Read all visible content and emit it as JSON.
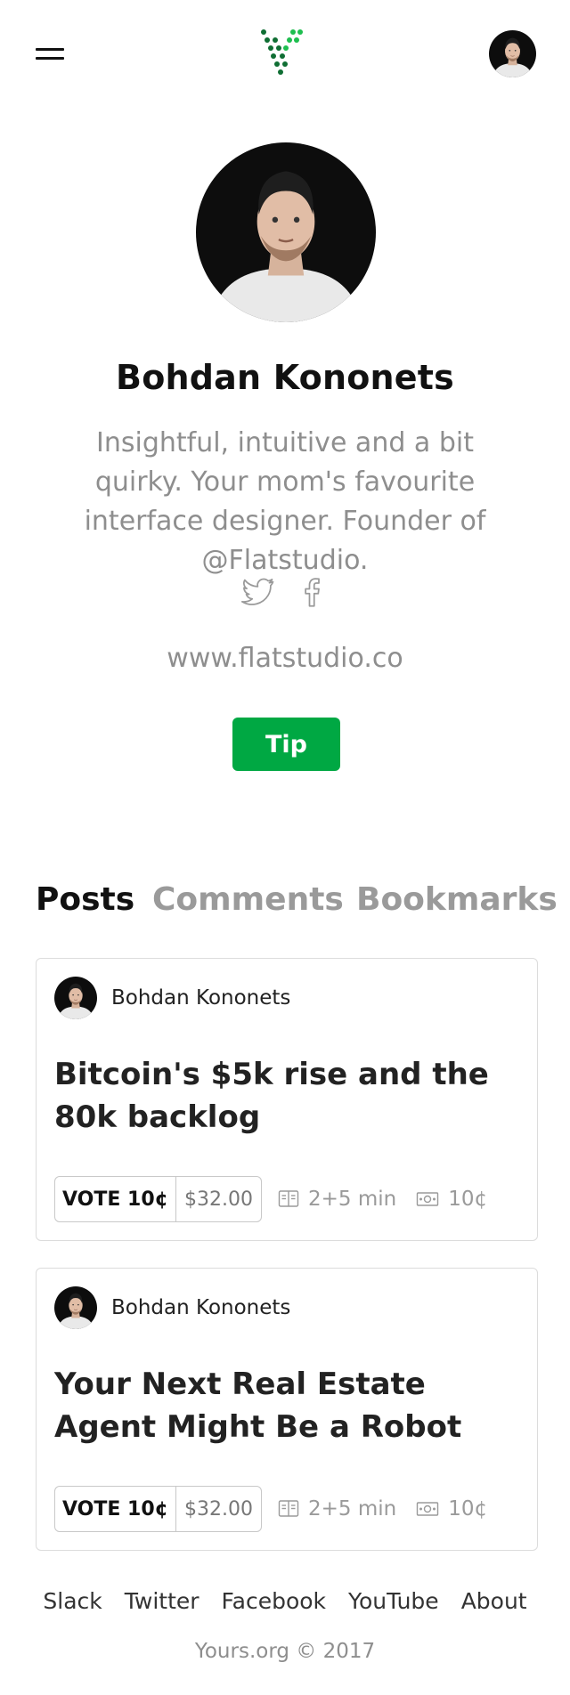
{
  "header": {
    "menu_icon": "hamburger-menu-icon",
    "logo_icon": "dotted-v-logo",
    "avatar": "user-avatar"
  },
  "colors": {
    "accent": "#00a843",
    "text_primary": "#111111",
    "text_muted": "#8e8e8e",
    "border": "#dcdcdc"
  },
  "profile": {
    "name": "Bohdan Kononets",
    "bio": "Insightful, intuitive and a bit quirky. Your mom's favourite interface designer. Founder of @Flatstudio.",
    "social_icons": [
      "twitter-icon",
      "facebook-icon"
    ],
    "website": "www.flatstudio.co",
    "tip_label": "Tip"
  },
  "tabs": [
    {
      "label": "Posts",
      "active": true
    },
    {
      "label": "Comments",
      "active": false
    },
    {
      "label": "Bookmarks",
      "active": false
    }
  ],
  "posts": [
    {
      "author": "Bohdan Kononets",
      "title": "Bitcoin's $5k rise and the 80k backlog",
      "vote_label": "VOTE 10¢",
      "amount": "$32.00",
      "read_time": "2+5 min",
      "price": "10¢"
    },
    {
      "author": "Bohdan Kononets",
      "title": "Your Next Real Estate Agent Might Be a Robot",
      "vote_label": "VOTE 10¢",
      "amount": "$32.00",
      "read_time": "2+5 min",
      "price": "10¢"
    }
  ],
  "footer": {
    "links": [
      "Slack",
      "Twitter",
      "Facebook",
      "YouTube",
      "About"
    ],
    "copyright": "Yours.org © 2017"
  }
}
